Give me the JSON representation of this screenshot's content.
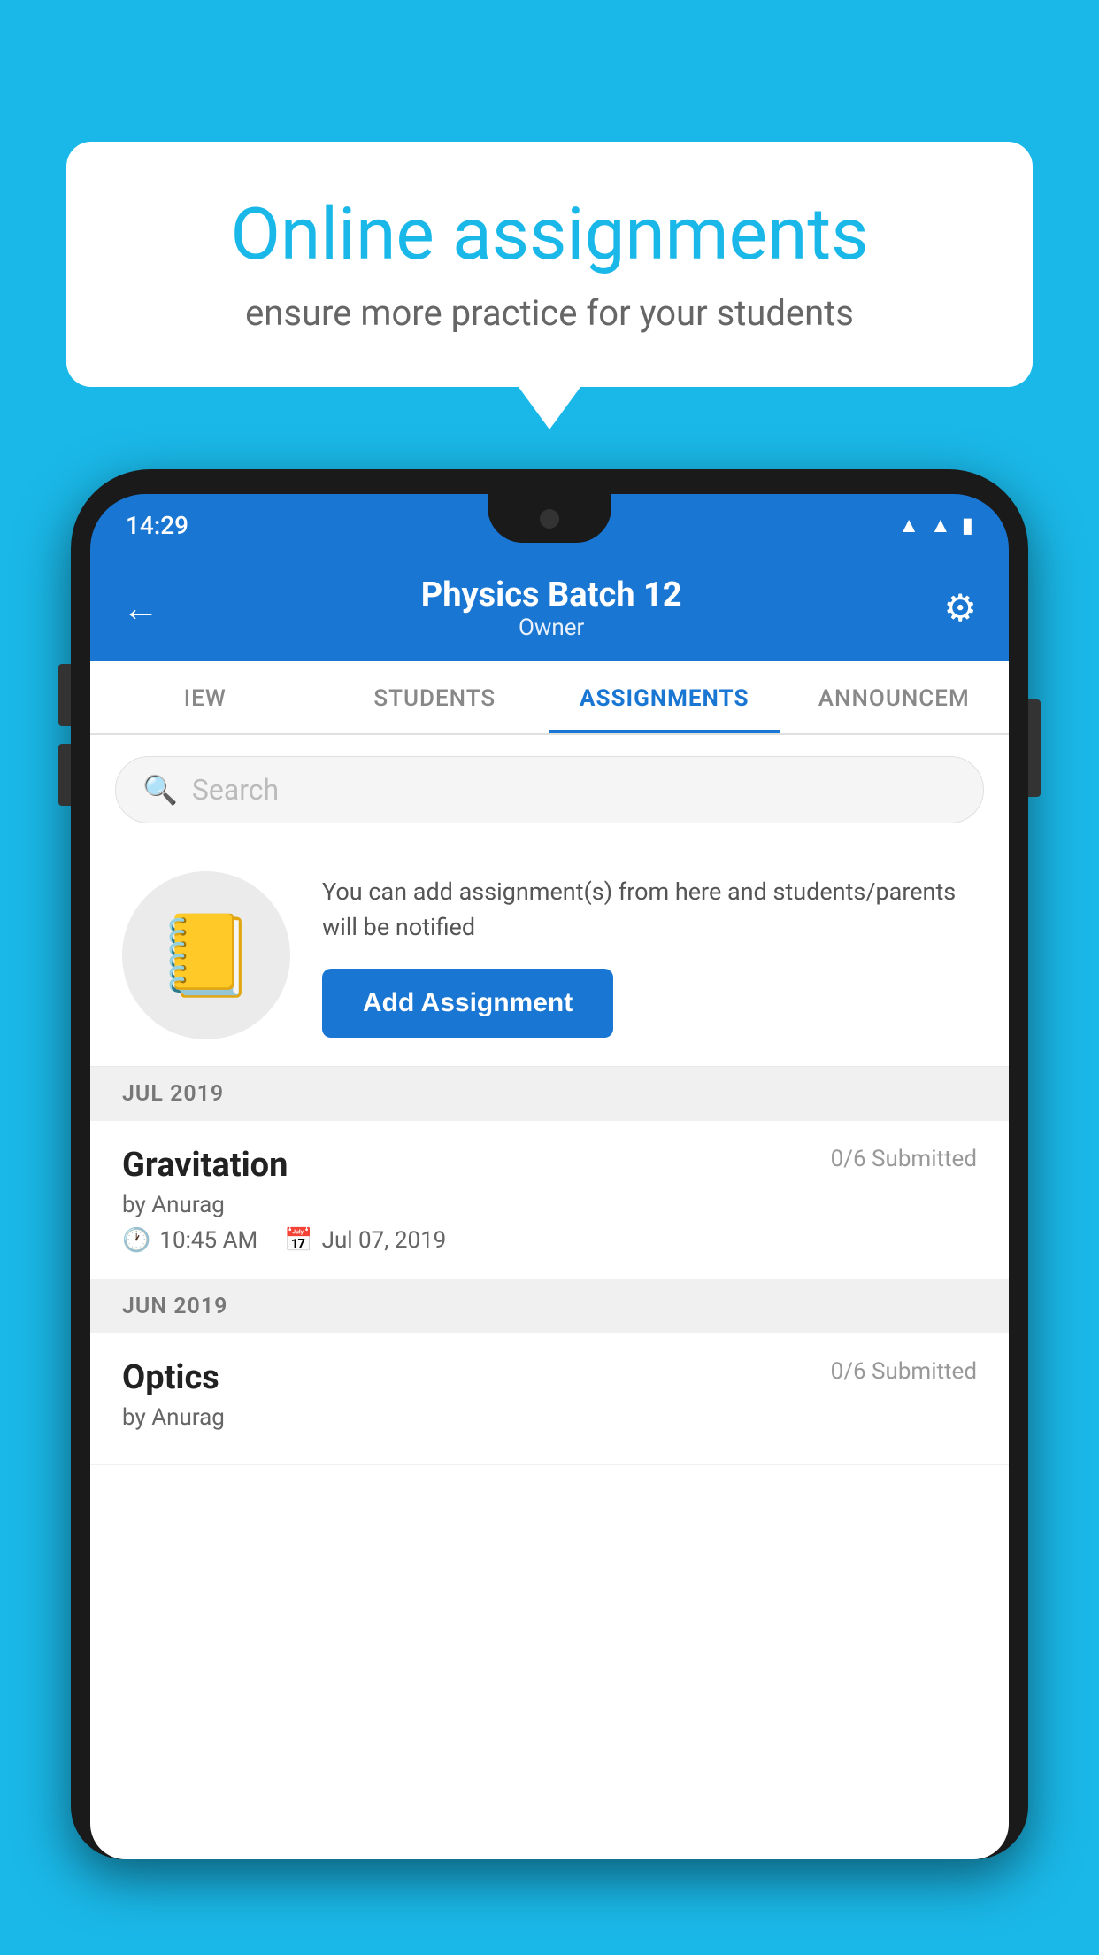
{
  "promo": {
    "title": "Online assignments",
    "subtitle": "ensure more practice for your students"
  },
  "phone": {
    "status_time": "14:29",
    "header": {
      "title": "Physics Batch 12",
      "subtitle": "Owner",
      "back_label": "←",
      "settings_label": "⚙"
    },
    "tabs": [
      {
        "label": "IEW",
        "active": false
      },
      {
        "label": "STUDENTS",
        "active": false
      },
      {
        "label": "ASSIGNMENTS",
        "active": true
      },
      {
        "label": "ANNOUNCEM",
        "active": false
      }
    ],
    "search": {
      "placeholder": "Search"
    },
    "add_section": {
      "description": "You can add assignment(s) from here and students/parents will be notified",
      "button_label": "Add Assignment"
    },
    "months": [
      {
        "label": "JUL 2019",
        "assignments": [
          {
            "name": "Gravitation",
            "submitted": "0/6 Submitted",
            "by": "by Anurag",
            "time": "10:45 AM",
            "date": "Jul 07, 2019"
          }
        ]
      },
      {
        "label": "JUN 2019",
        "assignments": [
          {
            "name": "Optics",
            "submitted": "0/6 Submitted",
            "by": "by Anurag",
            "time": "",
            "date": ""
          }
        ]
      }
    ]
  }
}
